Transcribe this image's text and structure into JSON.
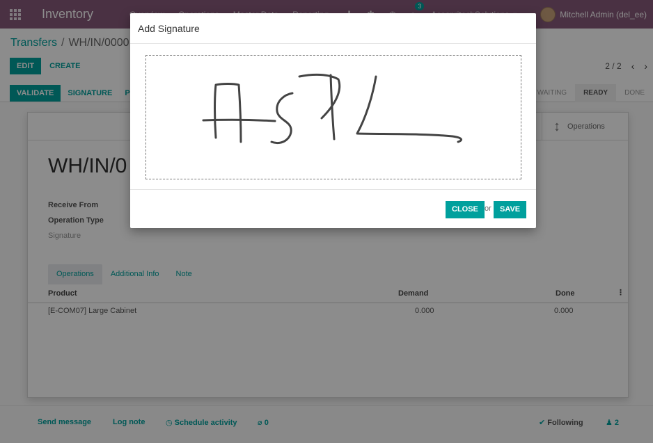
{
  "navbar": {
    "brand": "Inventory",
    "menu": [
      "Overview",
      "Operations",
      "Master Data",
      "Reporting"
    ],
    "messages_badge": "3",
    "company": "AcespritechSolutions",
    "user": "Mitchell Admin (del_ee)"
  },
  "breadcrumb": {
    "parent": "Transfers",
    "separator": "/",
    "current": "WH/IN/0000"
  },
  "control_panel": {
    "edit": "EDIT",
    "create": "CREATE",
    "pager": "2 / 2"
  },
  "statusbar": {
    "validate": "VALIDATE",
    "signature": "SIGNATURE",
    "print_partial": "P",
    "stages": [
      "WAITING",
      "READY",
      "DONE"
    ],
    "active_stage": "READY"
  },
  "form": {
    "title": "WH/IN/0",
    "operations_button": "Operations",
    "labels": {
      "receive_from": "Receive From",
      "operation_type": "Operation Type",
      "signature": "Signature"
    },
    "tabs": [
      "Operations",
      "Additional Info",
      "Note"
    ],
    "table": {
      "columns": [
        "Product",
        "Demand",
        "Done"
      ],
      "rows": [
        {
          "product": "[E-COM07] Large Cabinet",
          "demand": "0.000",
          "done": "0.000"
        }
      ]
    }
  },
  "chatter": {
    "send_message": "Send message",
    "log_note": "Log note",
    "schedule_activity": "Schedule activity",
    "attachments": "0",
    "following": "Following",
    "followers": "2"
  },
  "modal": {
    "title": "Add Signature",
    "close": "CLOSE",
    "or": "or",
    "save": "SAVE"
  }
}
